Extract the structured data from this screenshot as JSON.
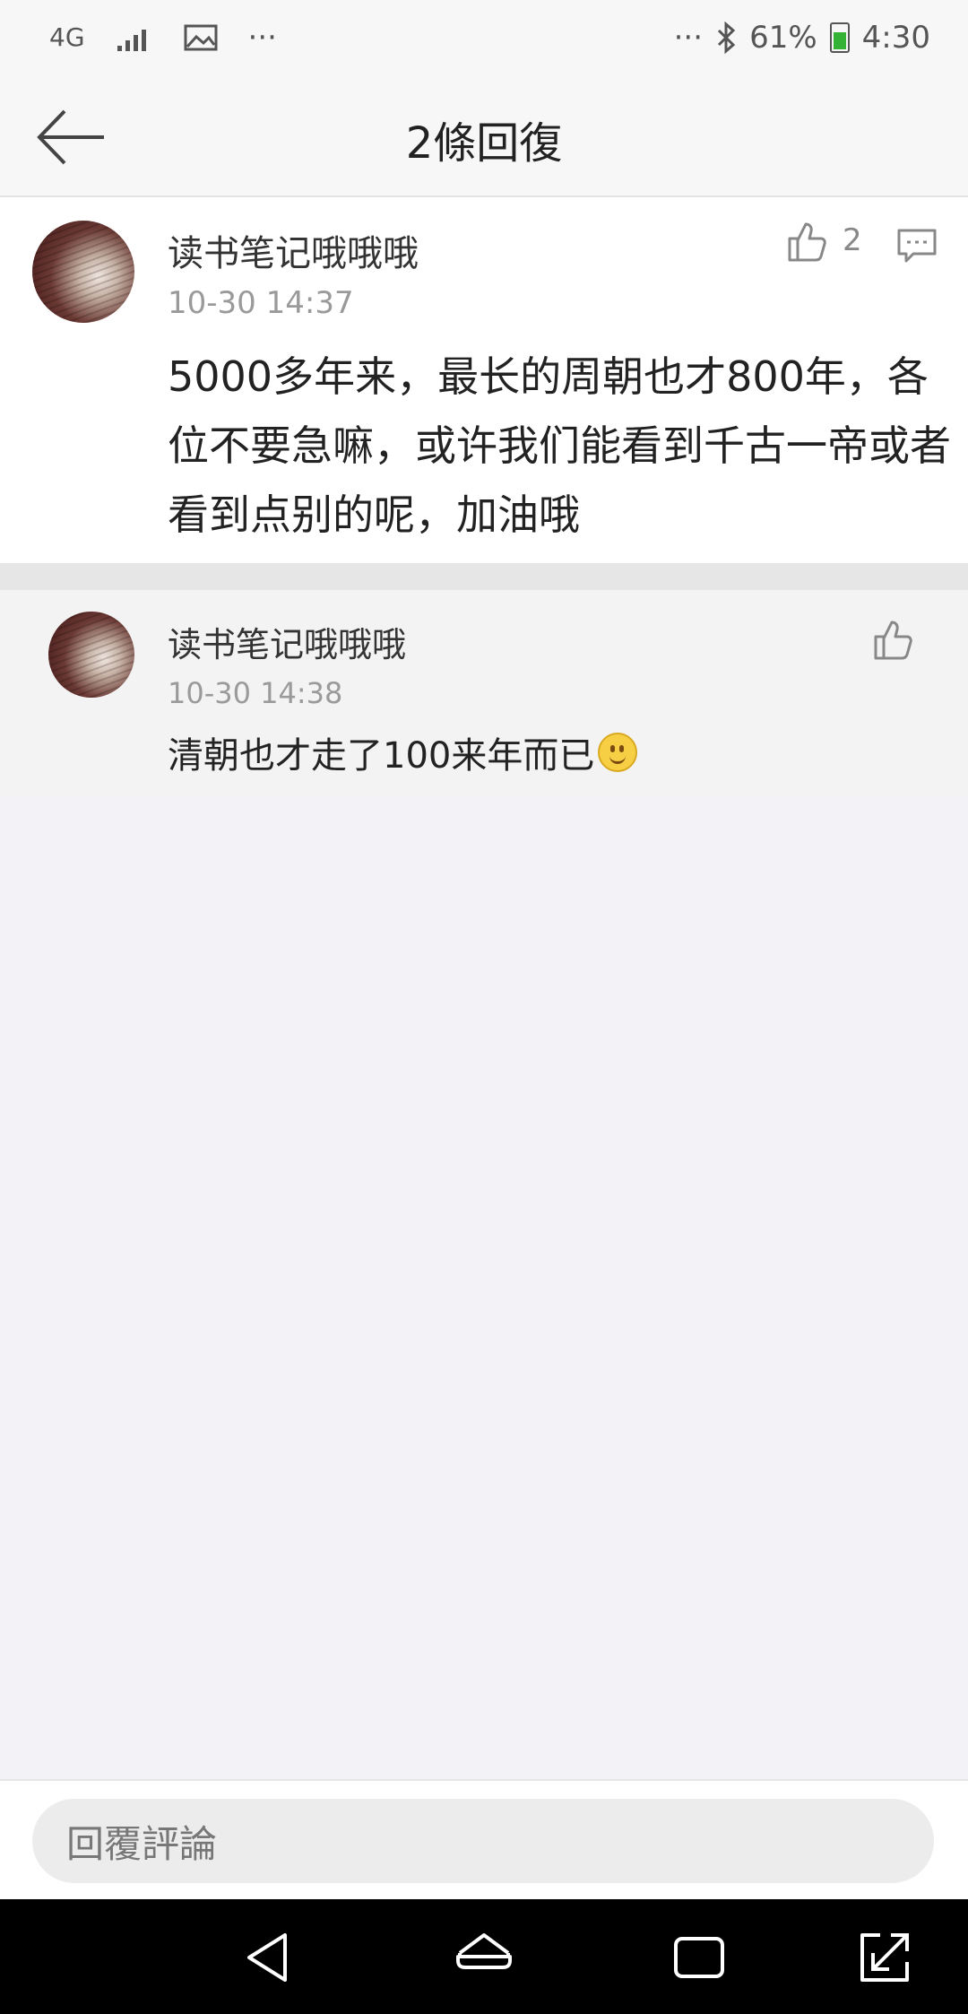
{
  "status_bar": {
    "network": "4G",
    "battery_percent": "61%",
    "time": "4:30",
    "more_left": "···",
    "more_right": "···"
  },
  "header": {
    "title": "2條回復"
  },
  "main_comment": {
    "username": "读书笔记哦哦哦",
    "timestamp": "10-30 14:37",
    "like_count": "2",
    "text": "5000多年来，最长的周朝也才800年，各位不要急嘛，或许我们能看到千古一帝或者看到点别的呢，加油哦"
  },
  "replies": [
    {
      "username": "读书笔记哦哦哦",
      "timestamp": "10-30 14:38",
      "text": "清朝也才走了100来年而已"
    }
  ],
  "reply_input": {
    "placeholder": "回覆評論"
  },
  "icons": {
    "back": "back-arrow-icon",
    "like": "thumbs-up-icon",
    "comment": "comment-icon",
    "emoji": "smiley-emoji-icon"
  },
  "colors": {
    "background": "#f2f2f7",
    "accent_battery": "#33b235"
  }
}
